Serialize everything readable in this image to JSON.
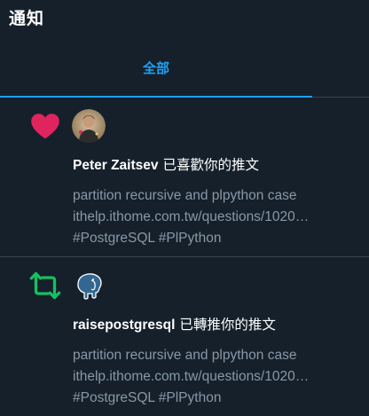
{
  "header": {
    "title": "通知"
  },
  "tabs": [
    {
      "label": "全部",
      "active": true
    }
  ],
  "colors": {
    "background": "#15202b",
    "accent": "#1da1f2",
    "like": "#e0245e",
    "retweet": "#17bf63",
    "secondary_text": "#8899a6",
    "divider": "#38444d"
  },
  "notifications": [
    {
      "type_icon": "heart-icon",
      "avatar": "user-avatar",
      "user": "Peter Zaitsev",
      "action": "已喜歡你的推文",
      "lines": [
        "partition recursive and plpython case",
        "ithelp.ithome.com.tw/questions/1020…",
        "#PostgreSQL #PlPython"
      ]
    },
    {
      "type_icon": "retweet-icon",
      "avatar": "postgresql-elephant-avatar",
      "user": "raisepostgresql",
      "action": "已轉推你的推文",
      "lines": [
        "partition recursive and plpython case",
        "ithelp.ithome.com.tw/questions/1020…",
        "#PostgreSQL #PlPython"
      ]
    }
  ]
}
